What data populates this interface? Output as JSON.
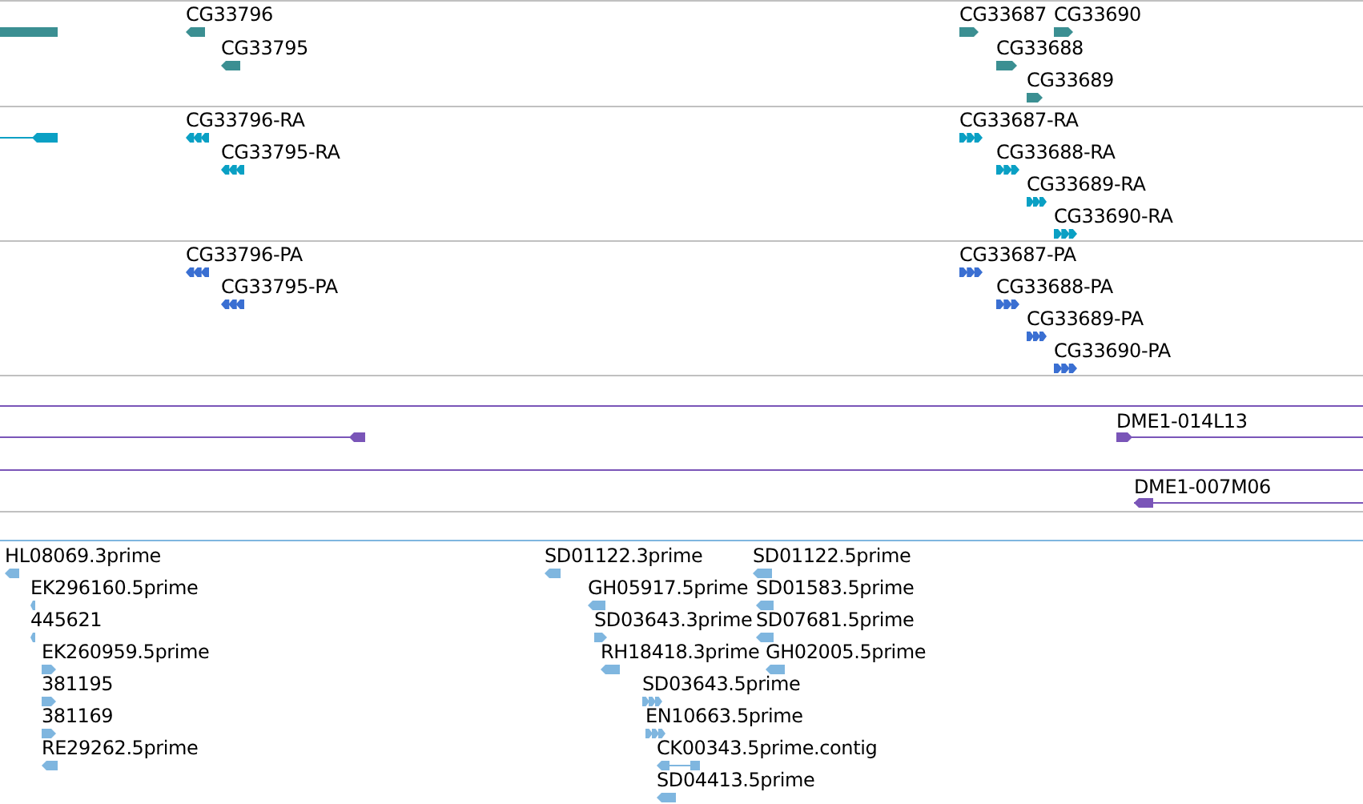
{
  "tracks": [
    {
      "kind": "gene",
      "color": "#3b8f92",
      "features": [
        {
          "reverse": true,
          "kind": "block"
        },
        {
          "label": "CG33796",
          "reverse": true,
          "kind": "block"
        },
        {
          "label": "CG33795",
          "reverse": true,
          "kind": "block"
        },
        {
          "label": "CG33687",
          "reverse": false,
          "kind": "block"
        },
        {
          "label": "CG33690",
          "reverse": false,
          "kind": "block"
        },
        {
          "label": "CG33688",
          "reverse": false,
          "kind": "block"
        },
        {
          "label": "CG33689",
          "reverse": false,
          "kind": "block"
        }
      ]
    },
    {
      "kind": "transcript",
      "color": "#0aa0c4",
      "features": [
        {
          "reverse": true,
          "kind": "block"
        },
        {
          "label": "CG33796-RA",
          "reverse": true,
          "kind": "exons"
        },
        {
          "label": "CG33795-RA",
          "reverse": true,
          "kind": "exons"
        },
        {
          "label": "CG33687-RA",
          "reverse": false,
          "kind": "exons"
        },
        {
          "label": "CG33688-RA",
          "reverse": false,
          "kind": "exons"
        },
        {
          "label": "CG33689-RA",
          "reverse": false,
          "kind": "exons"
        },
        {
          "label": "CG33690-RA",
          "reverse": false,
          "kind": "exons"
        }
      ]
    },
    {
      "kind": "protein",
      "color": "#3a6fd2",
      "features": [
        {
          "label": "CG33796-PA",
          "reverse": true,
          "kind": "exons"
        },
        {
          "label": "CG33795-PA",
          "reverse": true,
          "kind": "exons"
        },
        {
          "label": "CG33687-PA",
          "reverse": false,
          "kind": "exons"
        },
        {
          "label": "CG33688-PA",
          "reverse": false,
          "kind": "exons"
        },
        {
          "label": "CG33689-PA",
          "reverse": false,
          "kind": "exons"
        },
        {
          "label": "CG33690-PA",
          "reverse": false,
          "kind": "exons"
        }
      ]
    },
    {
      "kind": "clone",
      "color": "#7a55b8",
      "features": [
        {
          "reverse": true,
          "kind": "block"
        },
        {
          "label": "DME1-014L13",
          "reverse": false,
          "kind": "block"
        }
      ]
    },
    {
      "kind": "clone",
      "color": "#7a55b8",
      "features": [
        {
          "label": "DME1-007M06",
          "reverse": true,
          "kind": "block"
        }
      ]
    },
    {
      "kind": "est",
      "color": "#7fb6df",
      "features": [
        {
          "label": "HL08069.3prime",
          "reverse": true,
          "kind": "block"
        },
        {
          "label": "EK296160.5prime",
          "reverse": true,
          "kind": "block"
        },
        {
          "label": "445621",
          "reverse": true,
          "kind": "block"
        },
        {
          "label": "EK260959.5prime",
          "reverse": false,
          "kind": "block"
        },
        {
          "label": "381195",
          "reverse": false,
          "kind": "block"
        },
        {
          "label": "381169",
          "reverse": false,
          "kind": "block"
        },
        {
          "label": "RE29262.5prime",
          "reverse": true,
          "kind": "block"
        },
        {
          "label": "SD01122.3prime",
          "reverse": true,
          "kind": "block"
        },
        {
          "label": "GH05917.5prime",
          "reverse": true,
          "kind": "block"
        },
        {
          "label": "SD03643.3prime",
          "reverse": false,
          "kind": "block"
        },
        {
          "label": "RH18418.3prime",
          "reverse": true,
          "kind": "block"
        },
        {
          "label": "SD03643.5prime",
          "reverse": false,
          "kind": "exons"
        },
        {
          "label": "EN10663.5prime",
          "reverse": false,
          "kind": "exons"
        },
        {
          "label": "CK00343.5prime.contig",
          "reverse": true,
          "kind": "pair"
        },
        {
          "label": "SD04413.5prime",
          "reverse": true,
          "kind": "block"
        },
        {
          "label": "SD01122.5prime",
          "reverse": true,
          "kind": "block"
        },
        {
          "label": "SD01583.5prime",
          "reverse": true,
          "kind": "block"
        },
        {
          "label": "SD07681.5prime",
          "reverse": true,
          "kind": "block"
        },
        {
          "label": "GH02005.5prime",
          "reverse": true,
          "kind": "block"
        }
      ]
    }
  ]
}
